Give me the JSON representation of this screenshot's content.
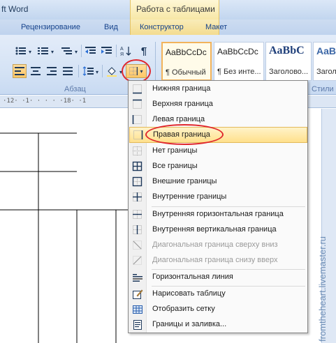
{
  "window": {
    "title": "ft Word"
  },
  "context_header": {
    "label": "Работа с таблицами"
  },
  "tabs": [
    "Рецензирование",
    "Вид",
    "Конструктор",
    "Макет"
  ],
  "ribbon": {
    "paragraph_group_label": "Абзац",
    "styles_group_label": "Стили",
    "styles": [
      {
        "preview": "AaBbCcDc",
        "name": "¶ Обычный"
      },
      {
        "preview": "AaBbCcDc",
        "name": "¶ Без инте..."
      },
      {
        "preview": "AaBbC",
        "name": "Заголово..."
      },
      {
        "preview": "AaBb",
        "name": "Заголо"
      }
    ],
    "pilcrow": "¶"
  },
  "ruler": {
    "text": "·12·  ·1·  ·  ·  ·  ·18·  ·1"
  },
  "watermark": "fromtheheart.livemaster.ru",
  "menu": {
    "items": [
      {
        "label": "Нижняя граница",
        "icon": "bottom-border-icon",
        "enabled": true
      },
      {
        "label": "Верхняя граница",
        "icon": "top-border-icon",
        "enabled": true
      },
      {
        "label": "Левая граница",
        "icon": "left-border-icon",
        "enabled": true
      },
      {
        "label": "Правая граница",
        "icon": "right-border-icon",
        "enabled": true,
        "highlighted": true
      },
      {
        "label": "Нет границы",
        "icon": "no-border-icon",
        "enabled": true
      },
      {
        "label": "Все границы",
        "icon": "all-borders-icon",
        "enabled": true
      },
      {
        "label": "Внешние границы",
        "icon": "outside-borders-icon",
        "enabled": true
      },
      {
        "label": "Внутренние границы",
        "icon": "inside-borders-icon",
        "enabled": true
      },
      {
        "label": "Внутренняя горизонтальная граница",
        "icon": "inside-horizontal-border-icon",
        "enabled": true
      },
      {
        "label": "Внутренняя вертикальная граница",
        "icon": "inside-vertical-border-icon",
        "enabled": true
      },
      {
        "label": "Диагональная граница сверху вниз",
        "icon": "diagonal-down-border-icon",
        "enabled": false
      },
      {
        "label": "Диагональная граница снизу вверх",
        "icon": "diagonal-up-border-icon",
        "enabled": false
      },
      {
        "label": "Горизонтальная линия",
        "icon": "horizontal-line-icon",
        "enabled": true
      },
      {
        "label": "Нарисовать таблицу",
        "icon": "draw-table-icon",
        "enabled": true
      },
      {
        "label": "Отобразить сетку",
        "icon": "view-gridlines-icon",
        "enabled": true
      },
      {
        "label": "Границы и заливка...",
        "icon": "borders-shading-icon",
        "enabled": true
      }
    ]
  },
  "colors": {
    "highlight_ring": "#e0262d",
    "menu_highlight": "#ffe08c",
    "ribbon_bg": "#d5e3f5"
  }
}
